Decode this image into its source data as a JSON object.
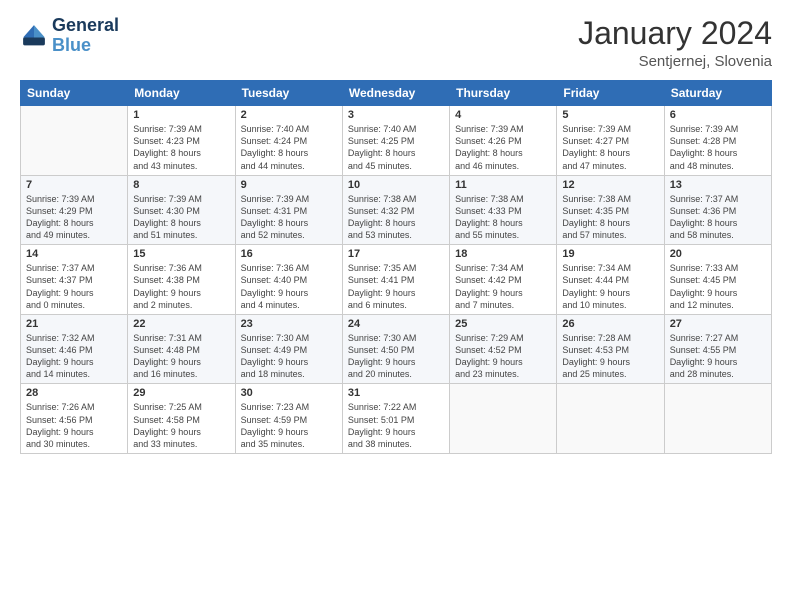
{
  "logo": {
    "line1": "General",
    "line2": "Blue"
  },
  "title": "January 2024",
  "location": "Sentjernej, Slovenia",
  "days_header": [
    "Sunday",
    "Monday",
    "Tuesday",
    "Wednesday",
    "Thursday",
    "Friday",
    "Saturday"
  ],
  "weeks": [
    [
      {
        "day": "",
        "info": ""
      },
      {
        "day": "1",
        "info": "Sunrise: 7:39 AM\nSunset: 4:23 PM\nDaylight: 8 hours\nand 43 minutes."
      },
      {
        "day": "2",
        "info": "Sunrise: 7:40 AM\nSunset: 4:24 PM\nDaylight: 8 hours\nand 44 minutes."
      },
      {
        "day": "3",
        "info": "Sunrise: 7:40 AM\nSunset: 4:25 PM\nDaylight: 8 hours\nand 45 minutes."
      },
      {
        "day": "4",
        "info": "Sunrise: 7:39 AM\nSunset: 4:26 PM\nDaylight: 8 hours\nand 46 minutes."
      },
      {
        "day": "5",
        "info": "Sunrise: 7:39 AM\nSunset: 4:27 PM\nDaylight: 8 hours\nand 47 minutes."
      },
      {
        "day": "6",
        "info": "Sunrise: 7:39 AM\nSunset: 4:28 PM\nDaylight: 8 hours\nand 48 minutes."
      }
    ],
    [
      {
        "day": "7",
        "info": "Sunrise: 7:39 AM\nSunset: 4:29 PM\nDaylight: 8 hours\nand 49 minutes."
      },
      {
        "day": "8",
        "info": "Sunrise: 7:39 AM\nSunset: 4:30 PM\nDaylight: 8 hours\nand 51 minutes."
      },
      {
        "day": "9",
        "info": "Sunrise: 7:39 AM\nSunset: 4:31 PM\nDaylight: 8 hours\nand 52 minutes."
      },
      {
        "day": "10",
        "info": "Sunrise: 7:38 AM\nSunset: 4:32 PM\nDaylight: 8 hours\nand 53 minutes."
      },
      {
        "day": "11",
        "info": "Sunrise: 7:38 AM\nSunset: 4:33 PM\nDaylight: 8 hours\nand 55 minutes."
      },
      {
        "day": "12",
        "info": "Sunrise: 7:38 AM\nSunset: 4:35 PM\nDaylight: 8 hours\nand 57 minutes."
      },
      {
        "day": "13",
        "info": "Sunrise: 7:37 AM\nSunset: 4:36 PM\nDaylight: 8 hours\nand 58 minutes."
      }
    ],
    [
      {
        "day": "14",
        "info": "Sunrise: 7:37 AM\nSunset: 4:37 PM\nDaylight: 9 hours\nand 0 minutes."
      },
      {
        "day": "15",
        "info": "Sunrise: 7:36 AM\nSunset: 4:38 PM\nDaylight: 9 hours\nand 2 minutes."
      },
      {
        "day": "16",
        "info": "Sunrise: 7:36 AM\nSunset: 4:40 PM\nDaylight: 9 hours\nand 4 minutes."
      },
      {
        "day": "17",
        "info": "Sunrise: 7:35 AM\nSunset: 4:41 PM\nDaylight: 9 hours\nand 6 minutes."
      },
      {
        "day": "18",
        "info": "Sunrise: 7:34 AM\nSunset: 4:42 PM\nDaylight: 9 hours\nand 7 minutes."
      },
      {
        "day": "19",
        "info": "Sunrise: 7:34 AM\nSunset: 4:44 PM\nDaylight: 9 hours\nand 10 minutes."
      },
      {
        "day": "20",
        "info": "Sunrise: 7:33 AM\nSunset: 4:45 PM\nDaylight: 9 hours\nand 12 minutes."
      }
    ],
    [
      {
        "day": "21",
        "info": "Sunrise: 7:32 AM\nSunset: 4:46 PM\nDaylight: 9 hours\nand 14 minutes."
      },
      {
        "day": "22",
        "info": "Sunrise: 7:31 AM\nSunset: 4:48 PM\nDaylight: 9 hours\nand 16 minutes."
      },
      {
        "day": "23",
        "info": "Sunrise: 7:30 AM\nSunset: 4:49 PM\nDaylight: 9 hours\nand 18 minutes."
      },
      {
        "day": "24",
        "info": "Sunrise: 7:30 AM\nSunset: 4:50 PM\nDaylight: 9 hours\nand 20 minutes."
      },
      {
        "day": "25",
        "info": "Sunrise: 7:29 AM\nSunset: 4:52 PM\nDaylight: 9 hours\nand 23 minutes."
      },
      {
        "day": "26",
        "info": "Sunrise: 7:28 AM\nSunset: 4:53 PM\nDaylight: 9 hours\nand 25 minutes."
      },
      {
        "day": "27",
        "info": "Sunrise: 7:27 AM\nSunset: 4:55 PM\nDaylight: 9 hours\nand 28 minutes."
      }
    ],
    [
      {
        "day": "28",
        "info": "Sunrise: 7:26 AM\nSunset: 4:56 PM\nDaylight: 9 hours\nand 30 minutes."
      },
      {
        "day": "29",
        "info": "Sunrise: 7:25 AM\nSunset: 4:58 PM\nDaylight: 9 hours\nand 33 minutes."
      },
      {
        "day": "30",
        "info": "Sunrise: 7:23 AM\nSunset: 4:59 PM\nDaylight: 9 hours\nand 35 minutes."
      },
      {
        "day": "31",
        "info": "Sunrise: 7:22 AM\nSunset: 5:01 PM\nDaylight: 9 hours\nand 38 minutes."
      },
      {
        "day": "",
        "info": ""
      },
      {
        "day": "",
        "info": ""
      },
      {
        "day": "",
        "info": ""
      }
    ]
  ]
}
